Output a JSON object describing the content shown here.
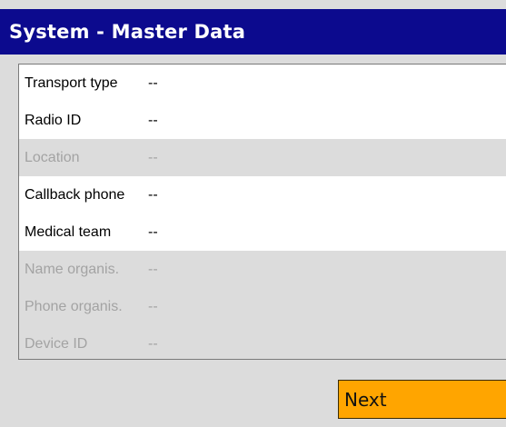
{
  "header": {
    "title": "System - Master Data"
  },
  "fields": [
    {
      "label": "Transport type",
      "value": "--",
      "enabled": true
    },
    {
      "label": "Radio ID",
      "value": "--",
      "enabled": true
    },
    {
      "label": "Location",
      "value": "--",
      "enabled": false
    },
    {
      "label": "Callback phone",
      "value": "--",
      "enabled": true
    },
    {
      "label": "Medical team",
      "value": "--",
      "enabled": true
    },
    {
      "label": "Name organis.",
      "value": "--",
      "enabled": false
    },
    {
      "label": "Phone organis.",
      "value": "--",
      "enabled": false
    },
    {
      "label": "Device ID",
      "value": "--",
      "enabled": false
    }
  ],
  "footer": {
    "next_label": "Next"
  },
  "colors": {
    "title_bar": "#0c0a8e",
    "title_text": "#ffffff",
    "background": "#dcdcdc",
    "enabled_row": "#ffffff",
    "disabled_text": "#a3a3a3",
    "next_button": "#ffa500"
  }
}
